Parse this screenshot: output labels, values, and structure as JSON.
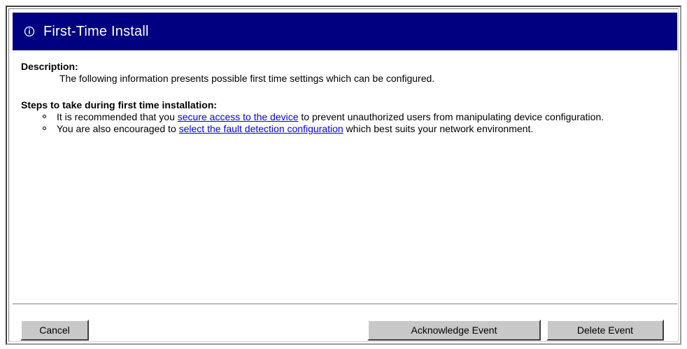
{
  "dialog": {
    "title": "First-Time Install",
    "title_icon": "info-circle-icon"
  },
  "description": {
    "heading": "Description:",
    "text": "The following information presents possible first time settings which can be configured."
  },
  "steps": {
    "heading": "Steps to take during first time installation:",
    "items": [
      {
        "before": "It is recommended that you ",
        "link": "secure access to the device",
        "after": " to prevent unauthorized users from manipulating device configuration."
      },
      {
        "before": "You are also encouraged to ",
        "link": "select the fault detection configuration",
        "after": " which best suits your network environment."
      }
    ]
  },
  "buttons": {
    "cancel": "Cancel",
    "acknowledge": "Acknowledge Event",
    "delete": "Delete Event"
  },
  "colors": {
    "title_bar": "#000080",
    "link": "#0000ee",
    "button_face": "#c8c8c8"
  }
}
